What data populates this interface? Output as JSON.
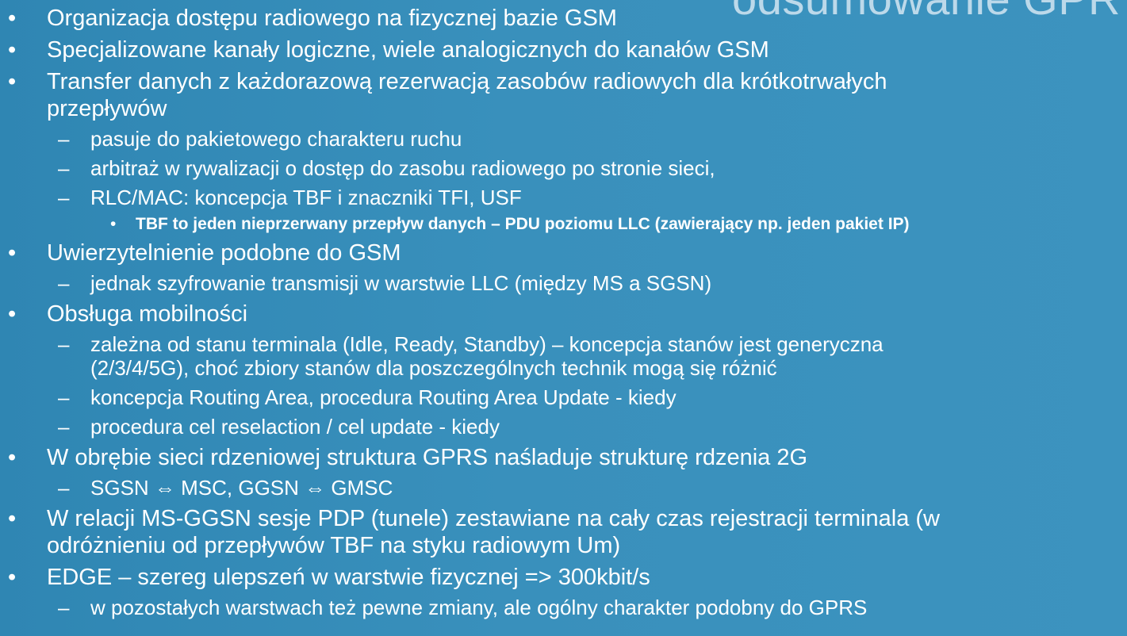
{
  "title_fragment": "odsumowanie GPR",
  "markers": {
    "bullet": "•",
    "dash": "–"
  },
  "items": [
    {
      "level": 1,
      "lines": [
        "Organizacja dostępu radiowego na fizycznej bazie GSM"
      ]
    },
    {
      "level": 1,
      "lines": [
        "Specjalizowane kanały logiczne, wiele analogicznych do kanałów GSM"
      ]
    },
    {
      "level": 1,
      "lines": [
        "Transfer danych z każdorazową rezerwacją zasobów radiowych dla krótkotrwałych",
        "przepływów"
      ]
    },
    {
      "level": 2,
      "lines": [
        "pasuje do pakietowego charakteru ruchu"
      ]
    },
    {
      "level": 2,
      "lines": [
        "arbitraż w rywalizacji o dostęp do zasobu radiowego po stronie sieci,"
      ]
    },
    {
      "level": 2,
      "lines": [
        "RLC/MAC: koncepcja TBF i znaczniki TFI, USF"
      ]
    },
    {
      "level": 3,
      "lines": [
        "TBF to jeden nieprzerwany przepływ danych – PDU poziomu LLC (zawierający np. jeden pakiet IP)"
      ]
    },
    {
      "level": 1,
      "lines": [
        "Uwierzytelnienie podobne do GSM"
      ]
    },
    {
      "level": 2,
      "lines": [
        "jednak szyfrowanie transmisji w warstwie LLC (między MS a SGSN)"
      ]
    },
    {
      "level": 1,
      "lines": [
        "Obsługa mobilności"
      ]
    },
    {
      "level": 2,
      "lines": [
        "zależna od stanu terminala (Idle, Ready, Standby) – koncepcja stanów jest generyczna",
        "(2/3/4/5G), choć zbiory stanów dla poszczególnych technik mogą się różnić"
      ]
    },
    {
      "level": 2,
      "lines": [
        "koncepcja Routing Area, procedura Routing Area Update - kiedy"
      ]
    },
    {
      "level": 2,
      "lines": [
        "procedura cel reselaction / cel update - kiedy"
      ]
    },
    {
      "level": 1,
      "lines": [
        "W obrębie sieci rdzeniowej struktura GPRS naśladuje strukturę rdzenia 2G"
      ]
    },
    {
      "level": 2,
      "lines": [
        "SGSN ⇔ MSC, GGSN ⇔ GMSC"
      ]
    },
    {
      "level": 1,
      "lines": [
        "W relacji MS-GGSN sesje PDP (tunele) zestawiane na cały czas rejestracji terminala (w",
        "odróżnieniu od przepływów TBF na styku radiowym Um)"
      ]
    },
    {
      "level": 1,
      "lines": [
        "EDGE – szereg ulepszeń w warstwie fizycznej => 300kbit/s"
      ]
    },
    {
      "level": 2,
      "lines": [
        "w pozostałych warstwach też pewne zmiany, ale ogólny charakter podobny do GPRS"
      ]
    }
  ]
}
